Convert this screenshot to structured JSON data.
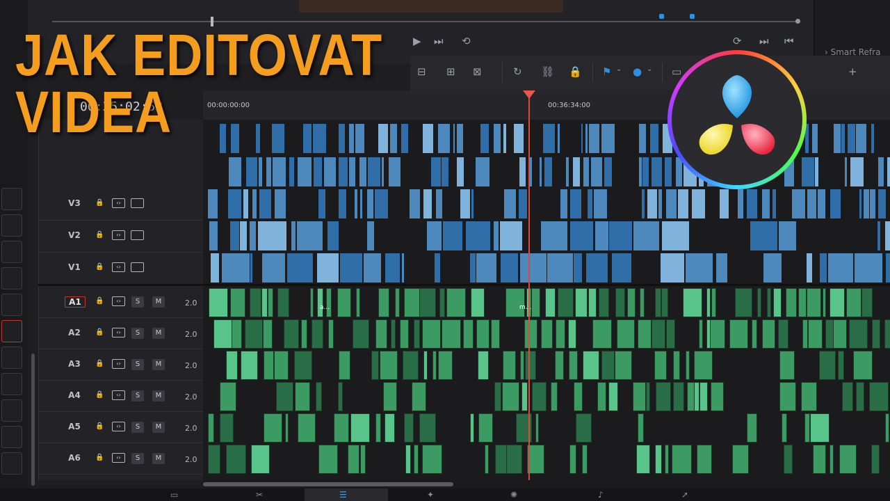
{
  "headline": {
    "line1": "JAK EDITOVAT",
    "line2": "VIDEA"
  },
  "viewer": {
    "side_panel_label": "Smart Refra"
  },
  "timeline": {
    "current_timecode": "00:35:02:52",
    "ruler_start": "00:00:00:00",
    "ruler_mark": "00:36:34:00",
    "video_tracks": [
      {
        "name": "V3"
      },
      {
        "name": "V2"
      },
      {
        "name": "V1"
      }
    ],
    "audio_tracks": [
      {
        "name": "A1",
        "volume": "2.0",
        "selected": true
      },
      {
        "name": "A2",
        "volume": "2.0"
      },
      {
        "name": "A3",
        "volume": "2.0"
      },
      {
        "name": "A4",
        "volume": "2.0"
      },
      {
        "name": "A5",
        "volume": "2.0"
      },
      {
        "name": "A6",
        "volume": "2.0"
      }
    ],
    "solo_label": "S",
    "mute_label": "M",
    "clip_label_a": "a...",
    "clip_label_m": "m..."
  },
  "colors": {
    "accent_orange": "#f59d1e",
    "video_clip": "#4d89bd",
    "audio_clip": "#3c9a63",
    "playhead": "#e0493a",
    "marker": "#2f8fe0"
  },
  "icons": {
    "toolbar": [
      "overwrite-icon",
      "replace-icon",
      "place-on-top-icon",
      "snapping-icon",
      "linked-selection-icon",
      "position-lock-icon",
      "flag-icon",
      "marker-icon",
      "zoom-icon"
    ],
    "transport": [
      "next-clip-icon",
      "loop-icon",
      "loop-playback-icon",
      "go-end-icon",
      "go-start-icon"
    ],
    "pages": [
      "media-page-icon",
      "cut-page-icon",
      "edit-page-icon",
      "fusion-page-icon",
      "color-page-icon",
      "fairlight-page-icon",
      "deliver-page-icon"
    ]
  }
}
